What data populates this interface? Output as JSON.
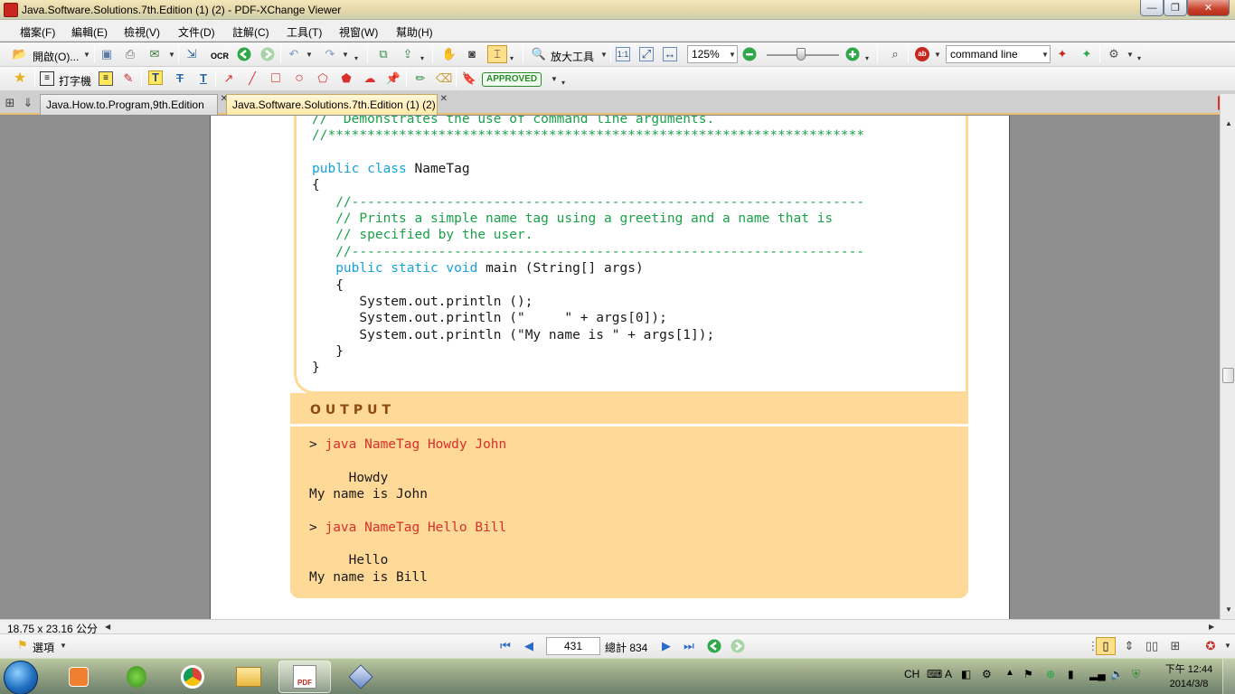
{
  "window": {
    "title": "Java.Software.Solutions.7th.Edition (1) (2) - PDF-XChange Viewer",
    "minimize_glyph": "—",
    "maximize_glyph": "❐",
    "close_glyph": "✕"
  },
  "menu": {
    "items": [
      "檔案(F)",
      "編輯(E)",
      "檢視(V)",
      "文件(D)",
      "註解(C)",
      "工具(T)",
      "視窗(W)",
      "幫助(H)"
    ]
  },
  "toolbar1": {
    "open_label": "開啟(O)...",
    "ocr_label": "OCR",
    "zoom_tool_label": "放大工具",
    "zoom_value": "125%",
    "search_value": "command line"
  },
  "toolbar2": {
    "typewriter_label": "打字機",
    "approved_label": "APPROVED"
  },
  "tabs": {
    "items": [
      {
        "label": "Java.How.to.Program,9th.Edition",
        "active": false
      },
      {
        "label": "Java.Software.Solutions.7th.Edition (1) (2)",
        "active": true
      }
    ]
  },
  "document": {
    "code_lines": [
      {
        "text": "//  Demonstrates the use of command line arguments.",
        "kind": "comment"
      },
      {
        "text": "//********************************************************************",
        "kind": "comment"
      },
      {
        "text": "",
        "kind": "plain"
      },
      {
        "kw": "public class",
        "rest": " NameTag",
        "kind": "keyword"
      },
      {
        "text": "{",
        "kind": "plain"
      },
      {
        "text": "   //-----------------------------------------------------------------",
        "kind": "comment"
      },
      {
        "text": "   // Prints a simple name tag using a greeting and a name that is",
        "kind": "comment"
      },
      {
        "text": "   // specified by the user.",
        "kind": "comment"
      },
      {
        "text": "   //-----------------------------------------------------------------",
        "kind": "comment"
      },
      {
        "pre": "   ",
        "kw": "public static void",
        "rest": " main (String[] args)",
        "kind": "keyword"
      },
      {
        "text": "   {",
        "kind": "plain"
      },
      {
        "text": "      System.out.println ();",
        "kind": "plain"
      },
      {
        "text": "      System.out.println (\"     \" + args[0]);",
        "kind": "plain"
      },
      {
        "text": "      System.out.println (\"My name is \" + args[1]);",
        "kind": "plain"
      },
      {
        "text": "   }",
        "kind": "plain"
      },
      {
        "text": "}",
        "kind": "plain"
      }
    ],
    "output_heading": "OUTPUT",
    "output_lines": [
      {
        "prompt": "> ",
        "cmd": "java NameTag Howdy John",
        "kind": "command"
      },
      {
        "text": "",
        "kind": "plain"
      },
      {
        "text": "     Howdy",
        "kind": "plain"
      },
      {
        "text": "My name is John",
        "kind": "plain"
      },
      {
        "text": "",
        "kind": "plain"
      },
      {
        "prompt": "> ",
        "cmd": "java NameTag Hello Bill",
        "kind": "command"
      },
      {
        "text": "",
        "kind": "plain"
      },
      {
        "text": "     Hello",
        "kind": "plain"
      },
      {
        "text": "My name is Bill",
        "kind": "plain"
      }
    ]
  },
  "status": {
    "page_size": "18.75 x 23.16 公分"
  },
  "navigation": {
    "options_label": "選項",
    "current_page": "431",
    "total_pages": "總計 834"
  },
  "taskbar": {
    "ime_label": "CH",
    "time": "下午 12:44",
    "date": "2014/3/8"
  },
  "colors": {
    "code_comment": "#1aa14a",
    "code_keyword": "#16a3d8",
    "output_command": "#d8302a",
    "output_panel": "#ffd998",
    "output_heading": "#8a4a10"
  }
}
